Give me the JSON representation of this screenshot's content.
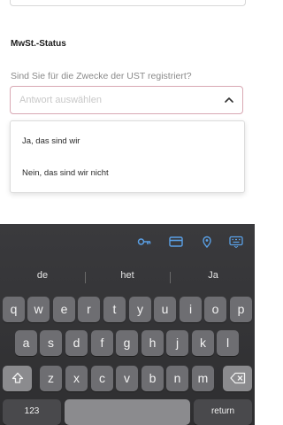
{
  "form": {
    "section_title": "MwSt.-Status",
    "question": "Sind Sie für die Zwecke der UST registriert?",
    "select_placeholder": "Antwort auswählen",
    "options": [
      "Ja, das sind wir",
      "Nein, das sind wir nicht"
    ]
  },
  "toolbar": {
    "icons": [
      "key-icon",
      "credit-card-icon",
      "location-pin-icon",
      "keyboard-icon"
    ],
    "accent": "#5aa0e6"
  },
  "suggestions": [
    "de",
    "het",
    "Ja"
  ],
  "keyboard": {
    "row1": [
      "q",
      "w",
      "e",
      "r",
      "t",
      "y",
      "u",
      "i",
      "o",
      "p"
    ],
    "row2": [
      "a",
      "s",
      "d",
      "f",
      "g",
      "h",
      "j",
      "k",
      "l"
    ],
    "row3": [
      "z",
      "x",
      "c",
      "v",
      "b",
      "n",
      "m"
    ],
    "numbers_label": "123",
    "return_label": "return"
  }
}
